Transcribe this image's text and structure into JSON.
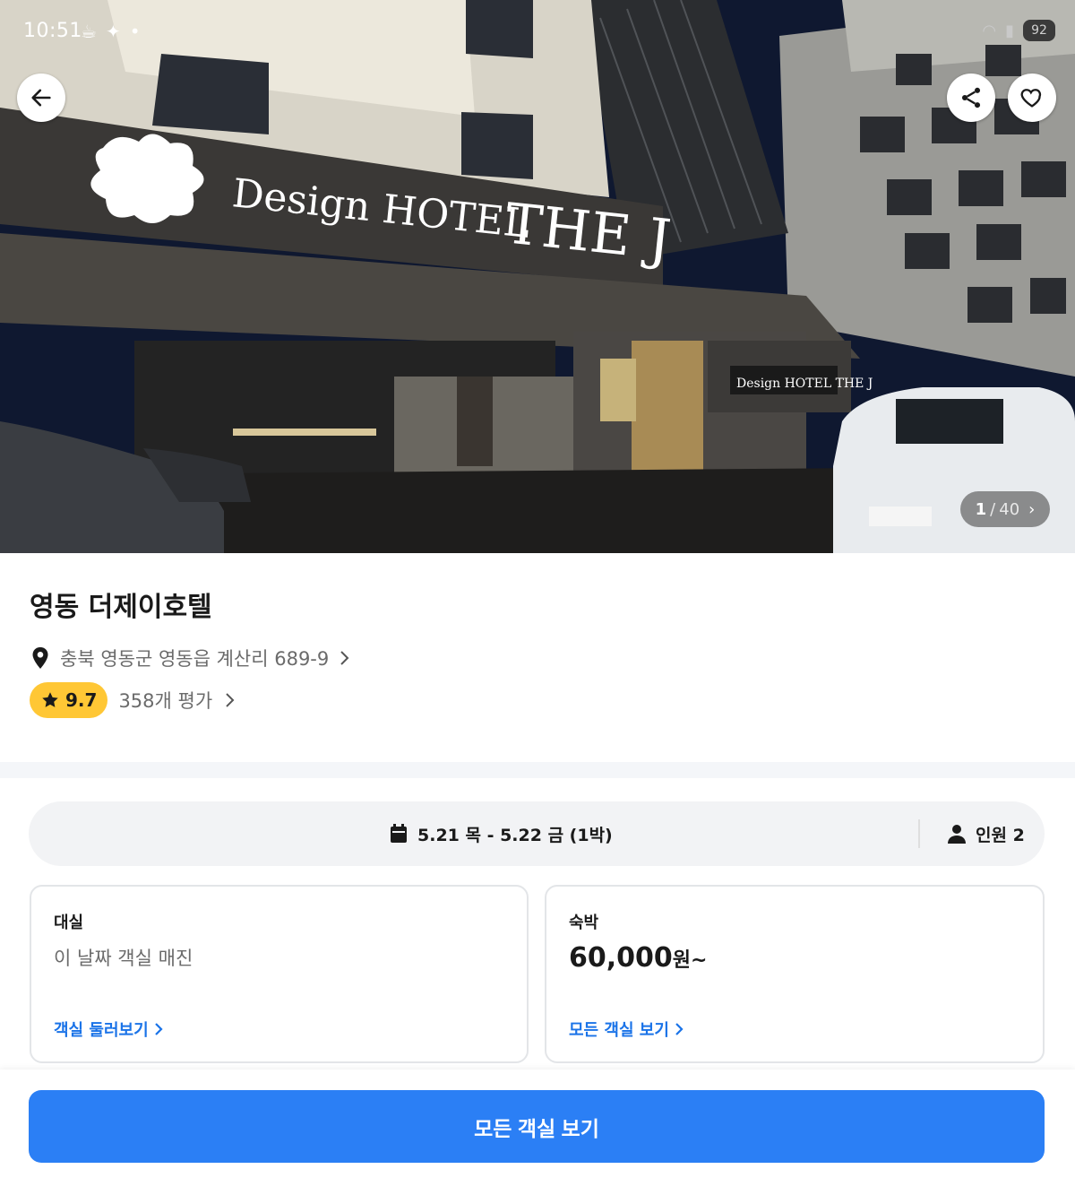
{
  "status_bar": {
    "time": "10:51",
    "battery": "92"
  },
  "hero": {
    "sign_small": "Design HOTEL",
    "sign_large": "THE J",
    "counter_current": "1",
    "counter_sep": "/",
    "counter_total": "40"
  },
  "hotel": {
    "name": "영동 더제이호텔",
    "address": "충북 영동군 영동읍 계산리 689-9",
    "rating": "9.7",
    "reviews": "358개 평가"
  },
  "booking": {
    "dates": "5.21 목 - 5.22 금 (1박)",
    "guests": "인원 2"
  },
  "cards": {
    "day_use": {
      "title": "대실",
      "status": "이 날짜 객실 매진",
      "link": "객실 둘러보기"
    },
    "stay": {
      "title": "숙박",
      "price": "60,000",
      "price_suffix": "원~",
      "link": "모든 객실 보기"
    }
  },
  "cta": {
    "label": "모든 객실 보기"
  },
  "colors": {
    "accent": "#2b7ff5",
    "link": "#1a73e8",
    "rating_badge": "#ffc735"
  }
}
